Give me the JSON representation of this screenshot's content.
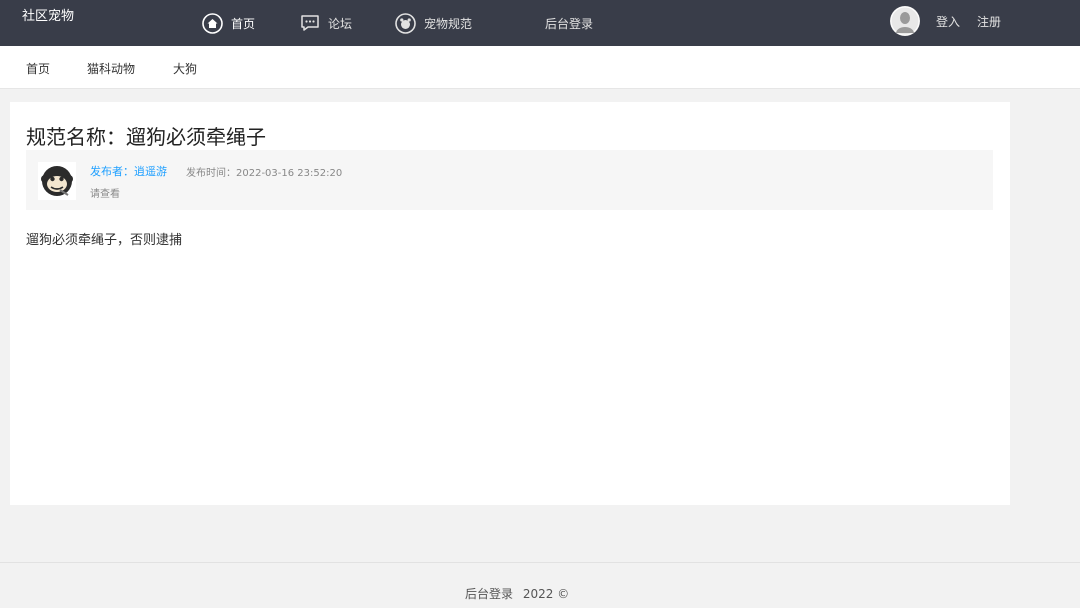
{
  "header": {
    "logo": "社区宠物",
    "nav": [
      {
        "label": "首页",
        "icon": "home-icon"
      },
      {
        "label": "论坛",
        "icon": "chat-icon"
      },
      {
        "label": "宠物规范",
        "icon": "pet-icon"
      },
      {
        "label": "后台登录"
      }
    ],
    "user": {
      "avatar_icon": "user-avatar-icon",
      "login": "登入",
      "register": "注册"
    }
  },
  "subnav": {
    "items": [
      "首页",
      "猫科动物",
      "大狗"
    ]
  },
  "article": {
    "title": "规范名称：遛狗必须牵绳子",
    "author": "发布者：逍遥游",
    "publish_time": "发布时间：2022-03-16 23:52:20",
    "summary": "请查看",
    "content": "遛狗必须牵绳子，否则逮捕"
  },
  "footer": {
    "admin_link": "后台登录",
    "copyright": "2022 ©"
  },
  "colors": {
    "topbar": "#393d49",
    "link": "#1e9fff",
    "background": "#f2f2f2"
  }
}
